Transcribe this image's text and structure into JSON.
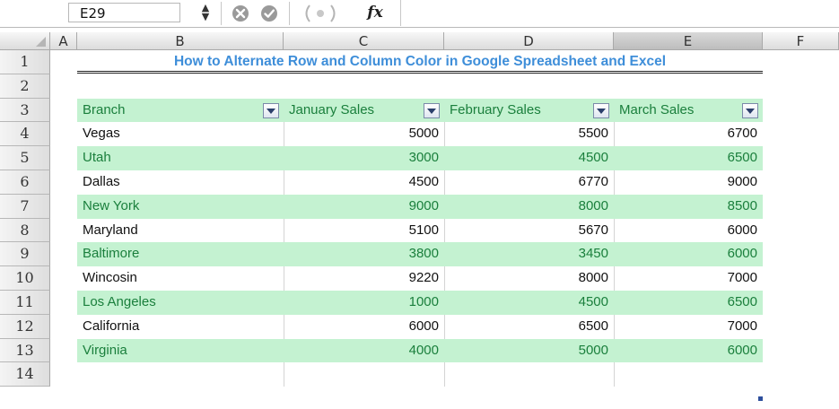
{
  "formula_bar": {
    "name_box": "E29",
    "fx_label": "fx",
    "formula": ""
  },
  "columns": [
    "A",
    "B",
    "C",
    "D",
    "E",
    "F"
  ],
  "rows": [
    "1",
    "2",
    "3",
    "4",
    "5",
    "6",
    "7",
    "8",
    "9",
    "10",
    "11",
    "12",
    "13",
    "14"
  ],
  "sheet": {
    "title": "How to Alternate Row and Column Color in Google Spreadsheet and Excel",
    "headers": [
      "Branch",
      "January Sales",
      "February Sales",
      "March Sales"
    ],
    "data": [
      [
        "Vegas",
        "5000",
        "5500",
        "6700"
      ],
      [
        "Utah",
        "3000",
        "4500",
        "6500"
      ],
      [
        "Dallas",
        "4500",
        "6770",
        "9000"
      ],
      [
        "New York",
        "9000",
        "8000",
        "8500"
      ],
      [
        "Maryland",
        "5100",
        "5670",
        "6000"
      ],
      [
        "Baltimore",
        "3800",
        "3450",
        "6000"
      ],
      [
        "Wincosin",
        "9220",
        "8000",
        "7000"
      ],
      [
        "Los Angeles",
        "1000",
        "4500",
        "6500"
      ],
      [
        "California",
        "6000",
        "6500",
        "7000"
      ],
      [
        "Virginia",
        "4000",
        "5000",
        "6000"
      ]
    ]
  },
  "colors": {
    "band": "#c4f2d1",
    "band_text": "#1a7f3c",
    "title": "#3e8ed9",
    "plain_text": "#111111"
  }
}
